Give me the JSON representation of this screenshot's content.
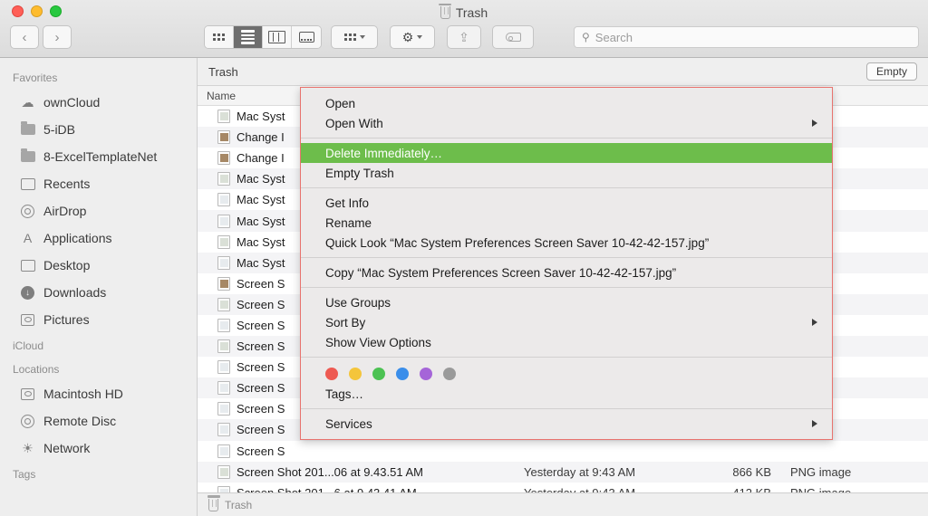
{
  "window": {
    "title": "Trash",
    "title_icon": "trash-icon",
    "traffic_lights": [
      "close-button",
      "minimize-button",
      "zoom-button"
    ]
  },
  "toolbar": {
    "back_label": "‹",
    "forward_label": "›",
    "view_modes": [
      {
        "name": "icon-view",
        "label": ""
      },
      {
        "name": "list-view",
        "label": ""
      },
      {
        "name": "column-view",
        "label": ""
      },
      {
        "name": "gallery-view",
        "label": ""
      }
    ],
    "active_view": "list-view",
    "group_button": "group-by-button",
    "action_button": "action-gear-button",
    "share_button": "share-button",
    "tags_button": "tags-button"
  },
  "search": {
    "placeholder": "Search",
    "value": "",
    "icon": "search-icon"
  },
  "sidebar": {
    "sections": [
      {
        "header": "Favorites",
        "items": [
          {
            "label": "ownCloud",
            "icon": "cloud-icon"
          },
          {
            "label": "5-iDB",
            "icon": "folder-icon"
          },
          {
            "label": "8-ExcelTemplateNet",
            "icon": "folder-icon"
          },
          {
            "label": "Recents",
            "icon": "clock-icon"
          },
          {
            "label": "AirDrop",
            "icon": "airdrop-icon"
          },
          {
            "label": "Applications",
            "icon": "applications-icon"
          },
          {
            "label": "Desktop",
            "icon": "desktop-icon"
          },
          {
            "label": "Downloads",
            "icon": "downloads-icon"
          },
          {
            "label": "Pictures",
            "icon": "pictures-icon"
          }
        ]
      },
      {
        "header": "iCloud",
        "items": []
      },
      {
        "header": "Locations",
        "items": [
          {
            "label": "Macintosh HD",
            "icon": "harddisk-icon"
          },
          {
            "label": "Remote Disc",
            "icon": "disc-icon"
          },
          {
            "label": "Network",
            "icon": "network-icon"
          }
        ]
      },
      {
        "header": "Tags",
        "items": []
      }
    ]
  },
  "content": {
    "path_title": "Trash",
    "empty_button": "Empty",
    "column_header_name": "Name",
    "status_text": "Trash",
    "status_icon": "trash-icon",
    "rows": [
      {
        "name": "Mac Syst",
        "date": "",
        "size": "",
        "kind": "",
        "icon": "jpg-file-icon"
      },
      {
        "name": "Change I",
        "date": "",
        "size": "",
        "kind": "",
        "icon": "photo-file-icon"
      },
      {
        "name": "Change I",
        "date": "",
        "size": "",
        "kind": "",
        "icon": "photo-file-icon"
      },
      {
        "name": "Mac Syst",
        "date": "",
        "size": "",
        "kind": "",
        "icon": "jpg-file-icon"
      },
      {
        "name": "Mac Syst",
        "date": "",
        "size": "",
        "kind": "",
        "icon": "doc-file-icon"
      },
      {
        "name": "Mac Syst",
        "date": "",
        "size": "",
        "kind": "",
        "icon": "doc-file-icon"
      },
      {
        "name": "Mac Syst",
        "date": "",
        "size": "",
        "kind": "",
        "icon": "jpg-file-icon"
      },
      {
        "name": "Mac Syst",
        "date": "",
        "size": "",
        "kind": "",
        "icon": "doc-file-icon"
      },
      {
        "name": "Screen S",
        "date": "",
        "size": "",
        "kind": "",
        "icon": "photo-file-icon"
      },
      {
        "name": "Screen S",
        "date": "",
        "size": "",
        "kind": "",
        "icon": "jpg-file-icon"
      },
      {
        "name": "Screen S",
        "date": "",
        "size": "",
        "kind": "",
        "icon": "doc-file-icon"
      },
      {
        "name": "Screen S",
        "date": "",
        "size": "",
        "kind": "",
        "icon": "jpg-file-icon"
      },
      {
        "name": "Screen S",
        "date": "",
        "size": "",
        "kind": "",
        "icon": "doc-file-icon"
      },
      {
        "name": "Screen S",
        "date": "",
        "size": "",
        "kind": "",
        "icon": "doc-file-icon"
      },
      {
        "name": "Screen S",
        "date": "",
        "size": "",
        "kind": "",
        "icon": "doc-file-icon"
      },
      {
        "name": "Screen S",
        "date": "",
        "size": "",
        "kind": "",
        "icon": "doc-file-icon"
      },
      {
        "name": "Screen S",
        "date": "",
        "size": "",
        "kind": "",
        "icon": "doc-file-icon"
      },
      {
        "name": "Screen Shot 201...06 at 9.43.51 AM",
        "date": "Yesterday at 9:43 AM",
        "size": "866 KB",
        "kind": "PNG image",
        "icon": "jpg-file-icon"
      },
      {
        "name": "Screen Shot 201...6 at 9.43.41 AM",
        "date": "Yesterday at 9:43 AM",
        "size": "412 KB",
        "kind": "PNG image",
        "icon": "doc-file-icon"
      }
    ]
  },
  "context_menu": {
    "border_color": "#e8736e",
    "highlight_color": "#6dbd4b",
    "groups": [
      {
        "items": [
          {
            "label": "Open",
            "submenu": false,
            "highlighted": false
          },
          {
            "label": "Open With",
            "submenu": true,
            "highlighted": false
          }
        ]
      },
      {
        "items": [
          {
            "label": "Delete Immediately…",
            "submenu": false,
            "highlighted": true
          },
          {
            "label": "Empty Trash",
            "submenu": false,
            "highlighted": false
          }
        ]
      },
      {
        "items": [
          {
            "label": "Get Info",
            "submenu": false,
            "highlighted": false
          },
          {
            "label": "Rename",
            "submenu": false,
            "highlighted": false
          },
          {
            "label": "Quick Look “Mac System Preferences Screen Saver 10-42-42-157.jpg”",
            "submenu": false,
            "highlighted": false
          }
        ]
      },
      {
        "items": [
          {
            "label": "Copy “Mac System Preferences Screen Saver 10-42-42-157.jpg”",
            "submenu": false,
            "highlighted": false
          }
        ]
      },
      {
        "items": [
          {
            "label": "Use Groups",
            "submenu": false,
            "highlighted": false
          },
          {
            "label": "Sort By",
            "submenu": true,
            "highlighted": false
          },
          {
            "label": "Show View Options",
            "submenu": false,
            "highlighted": false
          }
        ]
      },
      {
        "tag_colors": [
          "#f0564a",
          "#f5c432",
          "#4cc košice"
        ],
        "items": [
          {
            "label": "Tags…",
            "submenu": false,
            "highlighted": false
          }
        ]
      },
      {
        "items": [
          {
            "label": "Services",
            "submenu": true,
            "highlighted": false
          }
        ]
      }
    ],
    "tag_colors": [
      "#ee5a52",
      "#f4c53b",
      "#4cc253",
      "#3b8eea",
      "#a565d8",
      "#9a9a9a"
    ]
  }
}
